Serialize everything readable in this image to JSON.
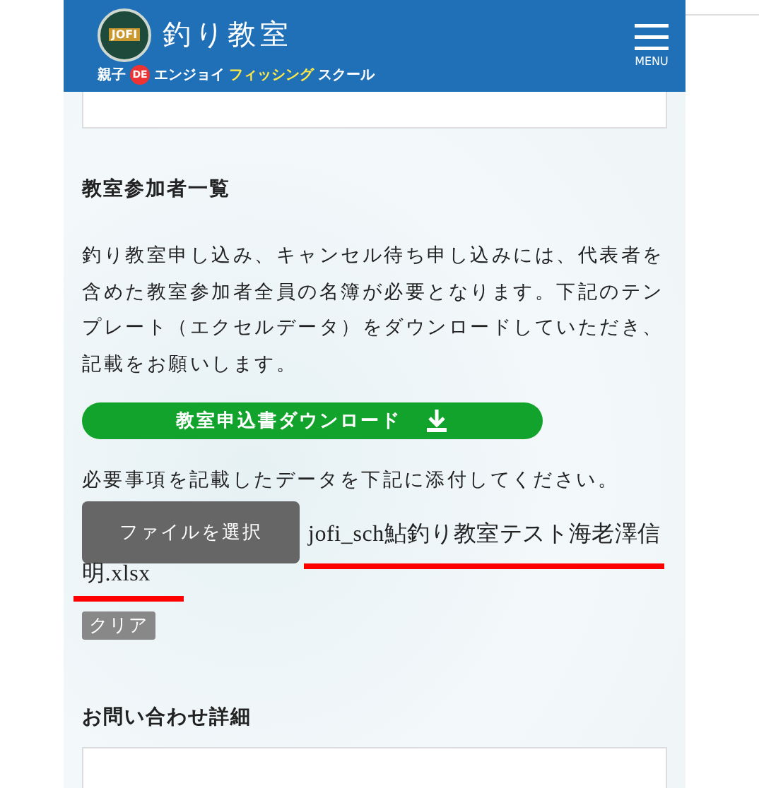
{
  "header": {
    "emblem_text": "JOFI",
    "site_title": "釣り教室",
    "tagline_prefix": "親子",
    "tagline_badge": "DE",
    "tagline_main": "エンジョイ",
    "tagline_highlight": "フィッシング",
    "tagline_suffix": "スクール",
    "menu_label": "MENU"
  },
  "participants": {
    "heading": "教室参加者一覧",
    "description": "釣り教室申し込み、キャンセル待ち申し込みには、代表者を含めた教室参加者全員の名簿が必要となります。下記のテンプレート（エクセルデータ）をダウンロードしていただき、記載をお願いします。",
    "download_button": "教室申込書ダウンロード",
    "attach_note": "必要事項を記載したデータを下記に添付してください。",
    "file_button": "ファイルを選択",
    "file_name_lines": [
      "jofi_sch鮎釣り教室テスト海老澤信",
      "明.xlsx"
    ],
    "clear_button": "クリア"
  },
  "inquiry": {
    "heading": "お問い合わせ詳細"
  }
}
